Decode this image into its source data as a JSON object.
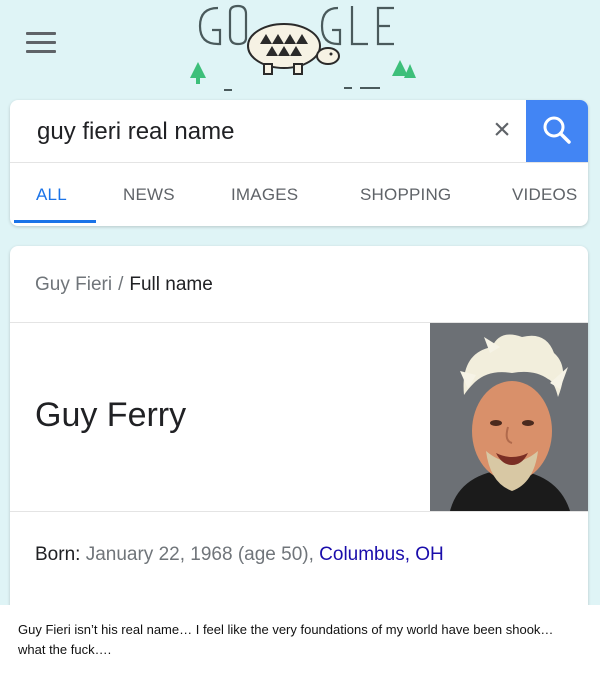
{
  "header": {
    "menu_icon": "hamburger-menu-icon",
    "doodle_text": "GOOGLE",
    "doodle_icon": "turtle-doodle-icon"
  },
  "search": {
    "query": "guy fieri real name",
    "clear_icon": "close-icon",
    "search_icon": "search-icon"
  },
  "tabs": [
    {
      "label": "ALL",
      "active": true
    },
    {
      "label": "NEWS",
      "active": false
    },
    {
      "label": "IMAGES",
      "active": false
    },
    {
      "label": "SHOPPING",
      "active": false
    },
    {
      "label": "VIDEOS",
      "active": false
    }
  ],
  "result": {
    "breadcrumb_parent": "Guy Fieri",
    "breadcrumb_separator": "/",
    "breadcrumb_current": "Full name",
    "answer": "Guy Ferry",
    "born_label": "Born:",
    "born_date": "January 22, 1968 (age 50),",
    "born_place": "Columbus, OH"
  },
  "caption": "Guy Fieri isn’t his real name… I feel like the very foundations of my world have been shook… what the fuck….",
  "colors": {
    "background": "#dff4f6",
    "accent": "#4285f4",
    "link": "#1a0dab"
  }
}
